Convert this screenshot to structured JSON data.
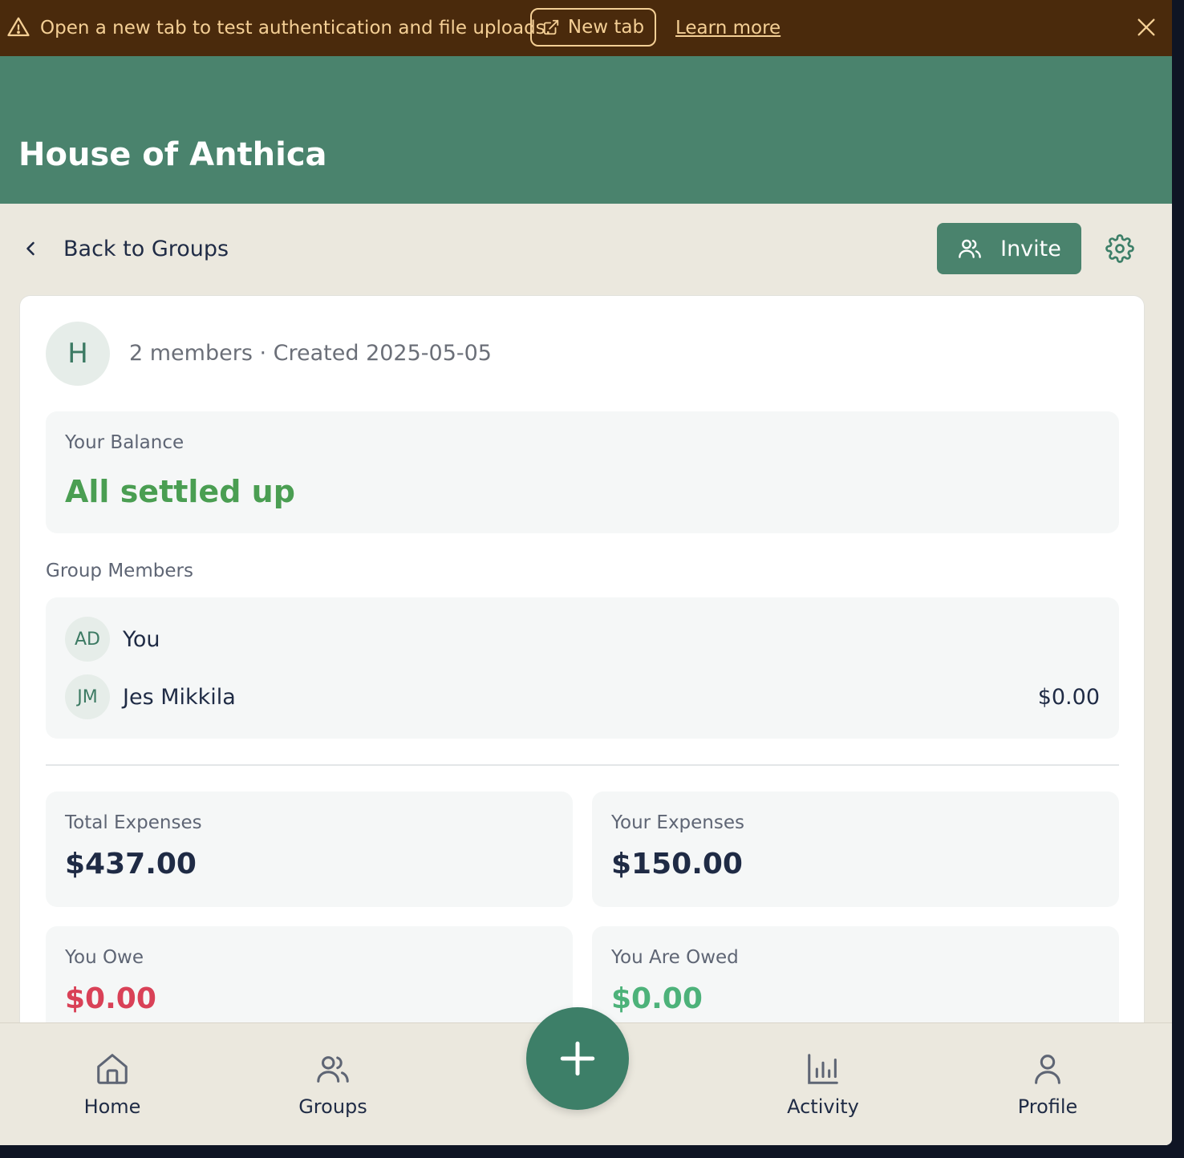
{
  "banner": {
    "message": "Open a new tab to test authentication and file uploads.",
    "new_tab_label": "New tab",
    "learn_more_label": "Learn more"
  },
  "header": {
    "title": "House of Anthica"
  },
  "toolbar": {
    "back_label": "Back to Groups",
    "invite_label": "Invite"
  },
  "group": {
    "avatar_letter": "H",
    "meta": "2 members · Created 2025-05-05"
  },
  "balance": {
    "label": "Your Balance",
    "value": "All settled up"
  },
  "members": {
    "title": "Group Members",
    "items": [
      {
        "initials": "AD",
        "name": "You",
        "amount": ""
      },
      {
        "initials": "JM",
        "name": "Jes Mikkila",
        "amount": "$0.00"
      }
    ]
  },
  "stats": {
    "total_expenses": {
      "label": "Total Expenses",
      "value": "$437.00"
    },
    "your_expenses": {
      "label": "Your Expenses",
      "value": "$150.00"
    },
    "you_owe": {
      "label": "You Owe",
      "value": "$0.00"
    },
    "you_are_owed": {
      "label": "You Are Owed",
      "value": "$0.00"
    }
  },
  "nav": {
    "home": "Home",
    "groups": "Groups",
    "activity": "Activity",
    "profile": "Profile"
  },
  "colors": {
    "primary": "#4a836d",
    "banner_bg": "#4a2a0c",
    "banner_text": "#f4cf95",
    "settled": "#4a9e52",
    "owe": "#d94157",
    "owed": "#4db27a"
  }
}
